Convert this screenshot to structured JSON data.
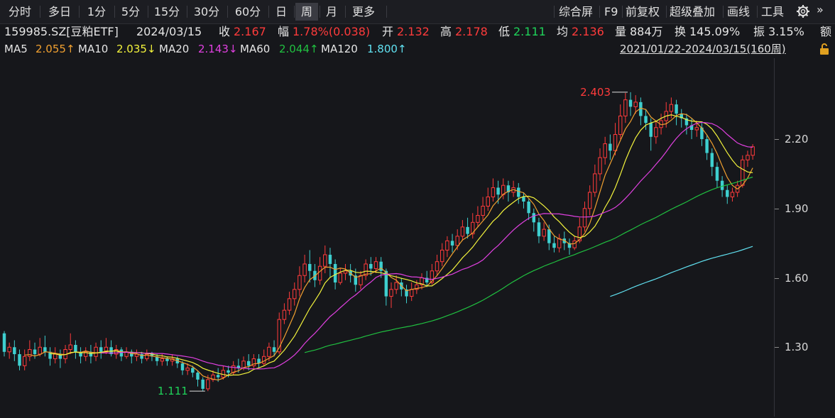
{
  "toolbar": {
    "tabs": [
      "分时",
      "多日",
      "1分",
      "5分",
      "15分",
      "30分",
      "60分",
      "日",
      "周",
      "月",
      "更多"
    ],
    "active_tab": "周",
    "tools": [
      "综合屏",
      "F9",
      "前复权",
      "超级叠加",
      "画线",
      "工具"
    ]
  },
  "info": {
    "code": "159985.SZ[豆粕ETF]",
    "date": "2024/03/15",
    "close_label": "收",
    "close": "2.167",
    "change_label": "幅",
    "change": "1.78%(0.038)",
    "open_label": "开",
    "open": "2.132",
    "high_label": "高",
    "high": "2.178",
    "low_label": "低",
    "low": "2.111",
    "avg_label": "均",
    "avg": "2.136",
    "vol_label": "量",
    "vol": "884万",
    "turnover_label": "换",
    "turnover": "145.09%",
    "amp_label": "振",
    "amp": "3.15%",
    "extra": "额"
  },
  "ma_legend": [
    {
      "name": "MA5",
      "value": "2.055↑",
      "color": "#f0a030"
    },
    {
      "name": "MA10",
      "value": "2.035↓",
      "color": "#f3f33c"
    },
    {
      "name": "MA20",
      "value": "2.143↓",
      "color": "#e040e0"
    },
    {
      "name": "MA60",
      "value": "2.044↑",
      "color": "#20c040"
    },
    {
      "name": "MA120",
      "value": "1.800↑",
      "color": "#60e0f0"
    }
  ],
  "range_text": "2021/01/22-2024/03/15(160周)",
  "colors": {
    "up": "#ff3b3b",
    "down": "#3ecfcf",
    "bg": "#16171b"
  },
  "chart_data": {
    "type": "candlestick",
    "y_ticks": [
      "1.30",
      "1.60",
      "1.90",
      "2.20"
    ],
    "ylim": [
      1.0,
      2.55
    ],
    "annotations": [
      {
        "label": "2.403",
        "kind": "high"
      },
      {
        "label": "1.111",
        "kind": "low"
      }
    ],
    "weeks": 160,
    "candles": [
      [
        1.36,
        1.28,
        1.37,
        1.26
      ],
      [
        1.28,
        1.3,
        1.32,
        1.25
      ],
      [
        1.3,
        1.27,
        1.33,
        1.24
      ],
      [
        1.27,
        1.22,
        1.29,
        1.2
      ],
      [
        1.22,
        1.26,
        1.29,
        1.2
      ],
      [
        1.26,
        1.29,
        1.33,
        1.24
      ],
      [
        1.29,
        1.27,
        1.32,
        1.25
      ],
      [
        1.27,
        1.3,
        1.34,
        1.26
      ],
      [
        1.3,
        1.28,
        1.35,
        1.26
      ],
      [
        1.28,
        1.25,
        1.3,
        1.22
      ],
      [
        1.25,
        1.27,
        1.3,
        1.23
      ],
      [
        1.27,
        1.25,
        1.29,
        1.21
      ],
      [
        1.25,
        1.29,
        1.31,
        1.23
      ],
      [
        1.29,
        1.31,
        1.36,
        1.27
      ],
      [
        1.31,
        1.28,
        1.33,
        1.25
      ],
      [
        1.28,
        1.26,
        1.3,
        1.23
      ],
      [
        1.26,
        1.28,
        1.3,
        1.24
      ],
      [
        1.28,
        1.26,
        1.31,
        1.23
      ],
      [
        1.26,
        1.3,
        1.32,
        1.24
      ],
      [
        1.3,
        1.28,
        1.33,
        1.25
      ],
      [
        1.28,
        1.3,
        1.34,
        1.27
      ],
      [
        1.3,
        1.27,
        1.33,
        1.26
      ],
      [
        1.27,
        1.29,
        1.31,
        1.25
      ],
      [
        1.29,
        1.26,
        1.3,
        1.24
      ],
      [
        1.26,
        1.28,
        1.3,
        1.25
      ],
      [
        1.28,
        1.26,
        1.29,
        1.23
      ],
      [
        1.26,
        1.27,
        1.29,
        1.24
      ],
      [
        1.27,
        1.25,
        1.28,
        1.23
      ],
      [
        1.25,
        1.27,
        1.29,
        1.24
      ],
      [
        1.27,
        1.26,
        1.28,
        1.24
      ],
      [
        1.26,
        1.24,
        1.27,
        1.22
      ],
      [
        1.24,
        1.25,
        1.27,
        1.22
      ],
      [
        1.25,
        1.24,
        1.26,
        1.22
      ],
      [
        1.24,
        1.25,
        1.27,
        1.22
      ],
      [
        1.25,
        1.23,
        1.26,
        1.21
      ],
      [
        1.23,
        1.2,
        1.24,
        1.18
      ],
      [
        1.2,
        1.21,
        1.23,
        1.18
      ],
      [
        1.21,
        1.19,
        1.22,
        1.17
      ],
      [
        1.19,
        1.16,
        1.2,
        1.13
      ],
      [
        1.16,
        1.12,
        1.17,
        1.111
      ],
      [
        1.12,
        1.16,
        1.18,
        1.11
      ],
      [
        1.16,
        1.18,
        1.2,
        1.15
      ],
      [
        1.18,
        1.17,
        1.21,
        1.15
      ],
      [
        1.17,
        1.2,
        1.22,
        1.16
      ],
      [
        1.2,
        1.19,
        1.22,
        1.17
      ],
      [
        1.19,
        1.22,
        1.24,
        1.18
      ],
      [
        1.22,
        1.21,
        1.25,
        1.19
      ],
      [
        1.21,
        1.24,
        1.26,
        1.2
      ],
      [
        1.24,
        1.22,
        1.27,
        1.2
      ],
      [
        1.22,
        1.25,
        1.27,
        1.21
      ],
      [
        1.25,
        1.23,
        1.27,
        1.21
      ],
      [
        1.23,
        1.26,
        1.29,
        1.22
      ],
      [
        1.26,
        1.3,
        1.32,
        1.24
      ],
      [
        1.3,
        1.28,
        1.33,
        1.26
      ],
      [
        1.28,
        1.42,
        1.45,
        1.27
      ],
      [
        1.42,
        1.46,
        1.49,
        1.4
      ],
      [
        1.46,
        1.51,
        1.54,
        1.44
      ],
      [
        1.51,
        1.55,
        1.58,
        1.48
      ],
      [
        1.55,
        1.61,
        1.65,
        1.52
      ],
      [
        1.61,
        1.66,
        1.7,
        1.58
      ],
      [
        1.66,
        1.63,
        1.72,
        1.58
      ],
      [
        1.63,
        1.59,
        1.66,
        1.56
      ],
      [
        1.59,
        1.65,
        1.69,
        1.57
      ],
      [
        1.65,
        1.7,
        1.74,
        1.62
      ],
      [
        1.7,
        1.66,
        1.73,
        1.6
      ],
      [
        1.66,
        1.58,
        1.68,
        1.55
      ],
      [
        1.58,
        1.62,
        1.64,
        1.57
      ],
      [
        1.62,
        1.63,
        1.66,
        1.59
      ],
      [
        1.63,
        1.61,
        1.66,
        1.58
      ],
      [
        1.61,
        1.57,
        1.64,
        1.54
      ],
      [
        1.57,
        1.61,
        1.63,
        1.55
      ],
      [
        1.61,
        1.66,
        1.68,
        1.59
      ],
      [
        1.66,
        1.64,
        1.69,
        1.61
      ],
      [
        1.64,
        1.67,
        1.69,
        1.62
      ],
      [
        1.67,
        1.63,
        1.69,
        1.6
      ],
      [
        1.63,
        1.52,
        1.64,
        1.48
      ],
      [
        1.52,
        1.55,
        1.58,
        1.47
      ],
      [
        1.55,
        1.58,
        1.61,
        1.53
      ],
      [
        1.58,
        1.55,
        1.6,
        1.52
      ],
      [
        1.55,
        1.52,
        1.57,
        1.49
      ],
      [
        1.52,
        1.55,
        1.58,
        1.5
      ],
      [
        1.55,
        1.57,
        1.59,
        1.53
      ],
      [
        1.57,
        1.6,
        1.62,
        1.55
      ],
      [
        1.6,
        1.58,
        1.63,
        1.56
      ],
      [
        1.58,
        1.63,
        1.66,
        1.57
      ],
      [
        1.63,
        1.67,
        1.7,
        1.61
      ],
      [
        1.67,
        1.72,
        1.75,
        1.65
      ],
      [
        1.72,
        1.76,
        1.78,
        1.69
      ],
      [
        1.76,
        1.74,
        1.79,
        1.71
      ],
      [
        1.74,
        1.78,
        1.81,
        1.72
      ],
      [
        1.78,
        1.82,
        1.85,
        1.76
      ],
      [
        1.82,
        1.79,
        1.86,
        1.77
      ],
      [
        1.79,
        1.84,
        1.88,
        1.77
      ],
      [
        1.84,
        1.87,
        1.91,
        1.82
      ],
      [
        1.87,
        1.91,
        1.95,
        1.85
      ],
      [
        1.91,
        1.95,
        1.99,
        1.89
      ],
      [
        1.95,
        1.99,
        2.03,
        1.93
      ],
      [
        1.99,
        1.96,
        2.02,
        1.92
      ],
      [
        1.96,
        2.0,
        2.03,
        1.94
      ],
      [
        2.0,
        1.97,
        2.02,
        1.93
      ],
      [
        1.97,
        1.99,
        2.02,
        1.95
      ],
      [
        1.99,
        1.95,
        2.01,
        1.92
      ],
      [
        1.95,
        1.93,
        1.97,
        1.9
      ],
      [
        1.93,
        1.88,
        1.94,
        1.85
      ],
      [
        1.88,
        1.84,
        1.9,
        1.8
      ],
      [
        1.84,
        1.78,
        1.86,
        1.75
      ],
      [
        1.78,
        1.81,
        1.84,
        1.76
      ],
      [
        1.81,
        1.75,
        1.83,
        1.72
      ],
      [
        1.75,
        1.73,
        1.78,
        1.71
      ],
      [
        1.73,
        1.77,
        1.79,
        1.71
      ],
      [
        1.77,
        1.75,
        1.8,
        1.72
      ],
      [
        1.75,
        1.73,
        1.77,
        1.7
      ],
      [
        1.73,
        1.76,
        1.78,
        1.72
      ],
      [
        1.76,
        1.82,
        1.86,
        1.75
      ],
      [
        1.82,
        1.9,
        1.93,
        1.8
      ],
      [
        1.9,
        1.97,
        2.0,
        1.87
      ],
      [
        1.97,
        2.05,
        2.09,
        1.95
      ],
      [
        2.05,
        2.12,
        2.16,
        2.02
      ],
      [
        2.12,
        2.18,
        2.21,
        2.09
      ],
      [
        2.18,
        2.15,
        2.22,
        2.11
      ],
      [
        2.15,
        2.22,
        2.27,
        2.13
      ],
      [
        2.22,
        2.3,
        2.35,
        2.2
      ],
      [
        2.3,
        2.37,
        2.4,
        2.27
      ],
      [
        2.37,
        2.34,
        2.403,
        2.3
      ],
      [
        2.34,
        2.36,
        2.39,
        2.31
      ],
      [
        2.36,
        2.3,
        2.38,
        2.26
      ],
      [
        2.3,
        2.27,
        2.33,
        2.24
      ],
      [
        2.27,
        2.21,
        2.29,
        2.15
      ],
      [
        2.21,
        2.25,
        2.28,
        2.18
      ],
      [
        2.25,
        2.28,
        2.31,
        2.22
      ],
      [
        2.28,
        2.32,
        2.36,
        2.25
      ],
      [
        2.32,
        2.35,
        2.38,
        2.29
      ],
      [
        2.35,
        2.31,
        2.37,
        2.26
      ],
      [
        2.31,
        2.29,
        2.33,
        2.25
      ],
      [
        2.29,
        2.26,
        2.31,
        2.22
      ],
      [
        2.26,
        2.24,
        2.29,
        2.2
      ],
      [
        2.24,
        2.25,
        2.28,
        2.21
      ],
      [
        2.25,
        2.2,
        2.27,
        2.17
      ],
      [
        2.2,
        2.14,
        2.22,
        2.11
      ],
      [
        2.14,
        2.08,
        2.16,
        2.04
      ],
      [
        2.08,
        2.02,
        2.1,
        1.99
      ],
      [
        2.02,
        1.98,
        2.04,
        1.95
      ],
      [
        1.98,
        1.95,
        2.0,
        1.92
      ],
      [
        1.95,
        1.97,
        1.99,
        1.93
      ],
      [
        1.97,
        2.0,
        2.02,
        1.95
      ],
      [
        2.0,
        2.11,
        2.13,
        1.99
      ],
      [
        2.11,
        2.13,
        2.15,
        2.08
      ],
      [
        2.13,
        2.167,
        2.178,
        2.111
      ]
    ]
  }
}
